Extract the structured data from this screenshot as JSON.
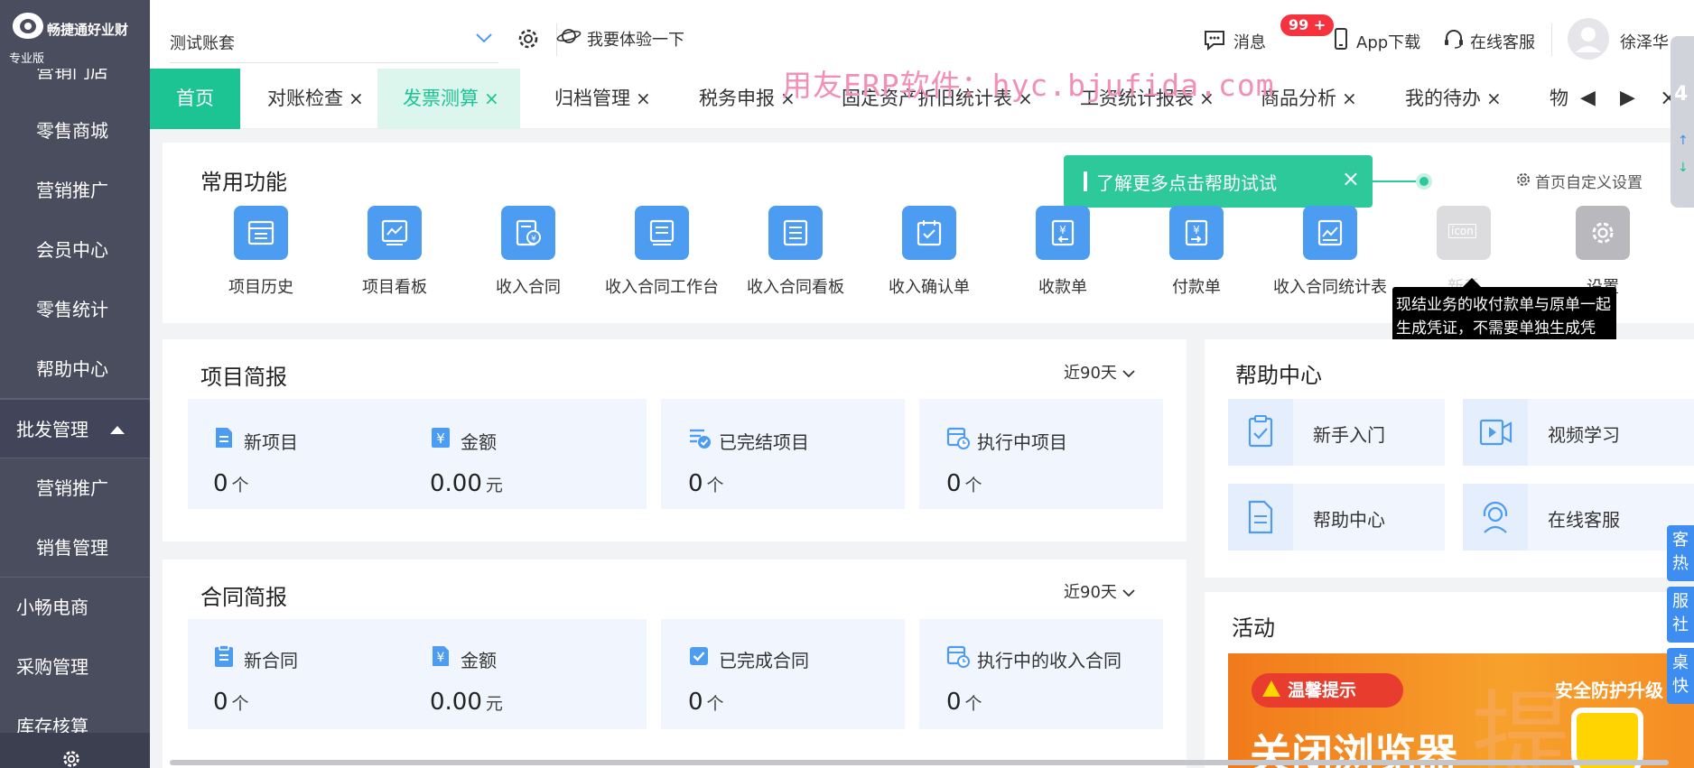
{
  "brand": {
    "name": "畅捷通好业财",
    "edition": "专业版"
  },
  "sidebar": {
    "items": [
      {
        "label": "营销门店"
      },
      {
        "label": "零售商城"
      },
      {
        "label": "营销推广"
      },
      {
        "label": "会员中心"
      },
      {
        "label": "零售统计"
      },
      {
        "label": "帮助中心"
      },
      {
        "label": "批发管理"
      },
      {
        "label": "营销推广"
      },
      {
        "label": "销售管理"
      },
      {
        "label": "小畅电商"
      },
      {
        "label": "采购管理"
      },
      {
        "label": "库存核算"
      }
    ]
  },
  "header": {
    "account": "测试账套",
    "try_label": "我要体验一下",
    "messages_label": "消息",
    "badge": "99 +",
    "app_label": "App下载",
    "service_label": "在线客服",
    "user": "徐泽华"
  },
  "tabs": [
    {
      "label": "首页"
    },
    {
      "label": "对账检查"
    },
    {
      "label": "发票测算"
    },
    {
      "label": "归档管理"
    },
    {
      "label": "税务申报"
    },
    {
      "label": "固定资产折旧统计表"
    },
    {
      "label": "工资统计报表"
    },
    {
      "label": "商品分析"
    },
    {
      "label": "我的待办"
    },
    {
      "label": "物"
    }
  ],
  "watermark": "用友ERP软件：hyc.bjufida.com",
  "common": {
    "title": "常用功能",
    "tip": "了解更多点击帮助试试",
    "customize": "首页自定义设置",
    "functions": [
      {
        "label": "项目历史",
        "icon": "document-list-icon"
      },
      {
        "label": "项目看板",
        "icon": "chart-board-icon"
      },
      {
        "label": "收入合同",
        "icon": "contract-yen-icon"
      },
      {
        "label": "收入合同工作台",
        "icon": "workbench-icon"
      },
      {
        "label": "收入合同看板",
        "icon": "board-list-icon"
      },
      {
        "label": "收入确认单",
        "icon": "checklist-icon"
      },
      {
        "label": "收款单",
        "icon": "receipt-yen-icon"
      },
      {
        "label": "付款单",
        "icon": "payment-yen-icon"
      },
      {
        "label": "收入合同统计表",
        "icon": "stats-chart-icon"
      },
      {
        "label": "新手",
        "icon": "placeholder-icon"
      },
      {
        "label": "设置",
        "icon": "settings-icon"
      }
    ],
    "placeholder_icon_text": "icon",
    "tooltip": "现结业务的收付款单与原单一起生成凭证，不需要单独生成凭证。包括进货单、销货单、费用支出单、其他收入单的现结业务。"
  },
  "project": {
    "title": "项目简报",
    "range": "近90天",
    "stats": [
      {
        "label": "新项目",
        "value": "0",
        "unit": "个"
      },
      {
        "label": "金额",
        "value": "0.00",
        "unit": "元"
      },
      {
        "label": "已完结项目",
        "value": "0",
        "unit": "个"
      },
      {
        "label": "执行中项目",
        "value": "0",
        "unit": "个"
      }
    ]
  },
  "contract": {
    "title": "合同简报",
    "range": "近90天",
    "stats": [
      {
        "label": "新合同",
        "value": "0",
        "unit": "个"
      },
      {
        "label": "金额",
        "value": "0.00",
        "unit": "元"
      },
      {
        "label": "已完成合同",
        "value": "0",
        "unit": "个"
      },
      {
        "label": "执行中的收入合同",
        "value": "0",
        "unit": "个"
      }
    ]
  },
  "help_center": {
    "title": "帮助中心",
    "items": [
      {
        "label": "新手入门"
      },
      {
        "label": "视频学习"
      },
      {
        "label": "帮助中心"
      },
      {
        "label": "在线客服"
      }
    ]
  },
  "activity": {
    "title": "活动",
    "pill": "温馨提示",
    "safe": "安全防护升级",
    "big": "关闭浏览器",
    "bg_char": "提"
  },
  "float_tabs": [
    "客热",
    "服社",
    "桌快"
  ],
  "float_top_num": "4",
  "colors": {
    "accent": "#1dc493",
    "icon_blue": "#4c9cf2",
    "sidebar": "#4a4d5e"
  }
}
